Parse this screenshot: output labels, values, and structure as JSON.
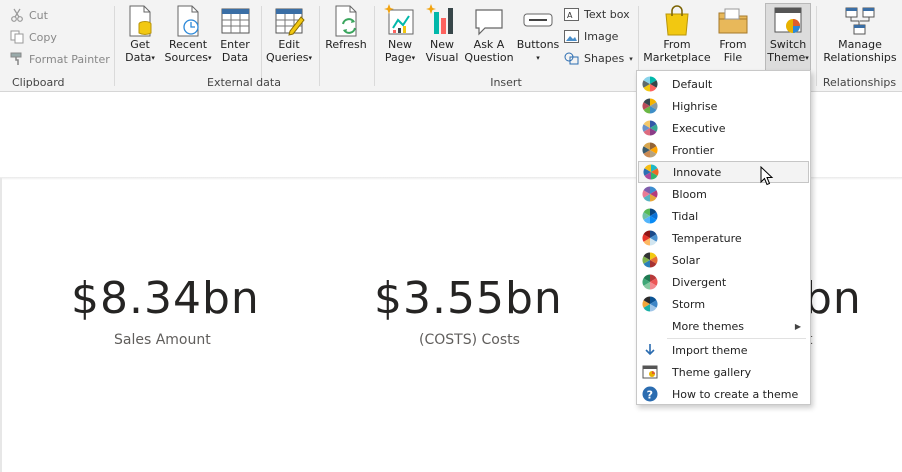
{
  "ribbon": {
    "clipboard": {
      "label": "Clipboard",
      "items": [
        {
          "label": "Cut",
          "icon": "scissors-icon"
        },
        {
          "label": "Copy",
          "icon": "copy-icon"
        },
        {
          "label": "Format Painter",
          "icon": "paintbrush-icon"
        }
      ]
    },
    "external_data": {
      "label": "External data",
      "buttons": [
        {
          "line1": "Get",
          "line2": "Data",
          "caret": "▾",
          "icon": "database-file-icon"
        },
        {
          "line1": "Recent",
          "line2": "Sources",
          "caret": "▾",
          "icon": "clock-file-icon"
        },
        {
          "line1": "Enter",
          "line2": "Data",
          "caret": "",
          "icon": "table-icon"
        },
        {
          "line1": "Edit",
          "line2": "Queries",
          "caret": "▾",
          "icon": "table-edit-icon"
        },
        {
          "line1": "Refresh",
          "line2": "",
          "caret": "",
          "icon": "refresh-icon"
        }
      ]
    },
    "insert": {
      "label": "Insert",
      "buttons": [
        {
          "line1": "New",
          "line2": "Page",
          "caret": "▾",
          "icon": "new-page-icon"
        },
        {
          "line1": "New",
          "line2": "Visual",
          "caret": "",
          "icon": "bar-chart-icon"
        },
        {
          "line1": "Ask A",
          "line2": "Question",
          "caret": "",
          "icon": "speech-bubble-icon"
        },
        {
          "line1": "Buttons",
          "line2": "",
          "caret": "▾",
          "icon": "button-icon"
        }
      ],
      "small": [
        {
          "label": "Text box",
          "icon": "textbox-icon"
        },
        {
          "label": "Image",
          "icon": "image-icon"
        },
        {
          "label": "Shapes",
          "caret": "▾",
          "icon": "shapes-icon"
        }
      ]
    },
    "themes": {
      "buttons": [
        {
          "line1": "From",
          "line2": "Marketplace",
          "caret": "",
          "icon": "marketplace-bag-icon"
        },
        {
          "line1": "From",
          "line2": "File",
          "caret": "",
          "icon": "folder-icon"
        },
        {
          "line1": "Switch",
          "line2": "Theme",
          "caret": "▾",
          "icon": "switch-theme-icon"
        }
      ]
    },
    "relationships": {
      "label": "Relationships",
      "buttons": [
        {
          "line1": "Manage",
          "line2": "Relationships",
          "caret": "",
          "icon": "relationships-icon"
        }
      ]
    }
  },
  "canvas": {
    "kpis": [
      {
        "value": "$8.34bn",
        "label": "Sales Amount"
      },
      {
        "value": "$3.55bn",
        "label": "(COSTS) Costs"
      },
      {
        "value": "bn",
        "label": "t"
      }
    ]
  },
  "theme_menu": {
    "themes": [
      {
        "label": "Default",
        "colors": [
          "#01b8aa",
          "#374649",
          "#fd625e",
          "#f2c80f",
          "#5f6b6d",
          "#8ad4eb"
        ]
      },
      {
        "label": "Highrise",
        "colors": [
          "#f5b300",
          "#8c9aa0",
          "#3e8ec6",
          "#6bb744",
          "#ba4c5a",
          "#37474f"
        ]
      },
      {
        "label": "Executive",
        "colors": [
          "#3257a8",
          "#37a794",
          "#8b3d88",
          "#dd6b7f",
          "#6b91c9",
          "#f5c869"
        ]
      },
      {
        "label": "Frontier",
        "colors": [
          "#936437",
          "#ffa500",
          "#b5a27f",
          "#ca8a53",
          "#3b5b6c",
          "#d7a64f"
        ]
      },
      {
        "label": "Innovate",
        "colors": [
          "#1fb8c6",
          "#ec6a24",
          "#33b46e",
          "#ab4a9c",
          "#2a6eb3",
          "#f5bd13"
        ]
      },
      {
        "label": "Bloom",
        "colors": [
          "#3c8dd0",
          "#b43b7b",
          "#e6a739",
          "#56b3c1",
          "#e87a95",
          "#7f5dac"
        ]
      },
      {
        "label": "Tidal",
        "colors": [
          "#094782",
          "#0b72d7",
          "#098bf5",
          "#54b5fb",
          "#71c0a7",
          "#57b956"
        ]
      },
      {
        "label": "Temperature",
        "colors": [
          "#1a4a8a",
          "#4a91cf",
          "#d1e5f0",
          "#fdb863",
          "#e6332a",
          "#8f1414"
        ]
      },
      {
        "label": "Solar",
        "colors": [
          "#f3c911",
          "#e66c37",
          "#a83232",
          "#2a7fb8",
          "#7fb24c",
          "#333333"
        ]
      },
      {
        "label": "Divergent",
        "colors": [
          "#b73a3a",
          "#ec5656",
          "#f28a90",
          "#88c9a1",
          "#3ea776",
          "#1f7a52"
        ]
      },
      {
        "label": "Storm",
        "colors": [
          "#0b5394",
          "#3d85c6",
          "#9fc5e8",
          "#1ab0a6",
          "#f1a63a",
          "#2b2b2b"
        ]
      }
    ],
    "more_themes": "More themes",
    "actions": [
      {
        "label": "Import theme",
        "icon": "import-arrow-icon"
      },
      {
        "label": "Theme gallery",
        "icon": "theme-gallery-icon"
      },
      {
        "label": "How to create a theme",
        "icon": "help-icon"
      }
    ],
    "hovered": "Innovate"
  }
}
